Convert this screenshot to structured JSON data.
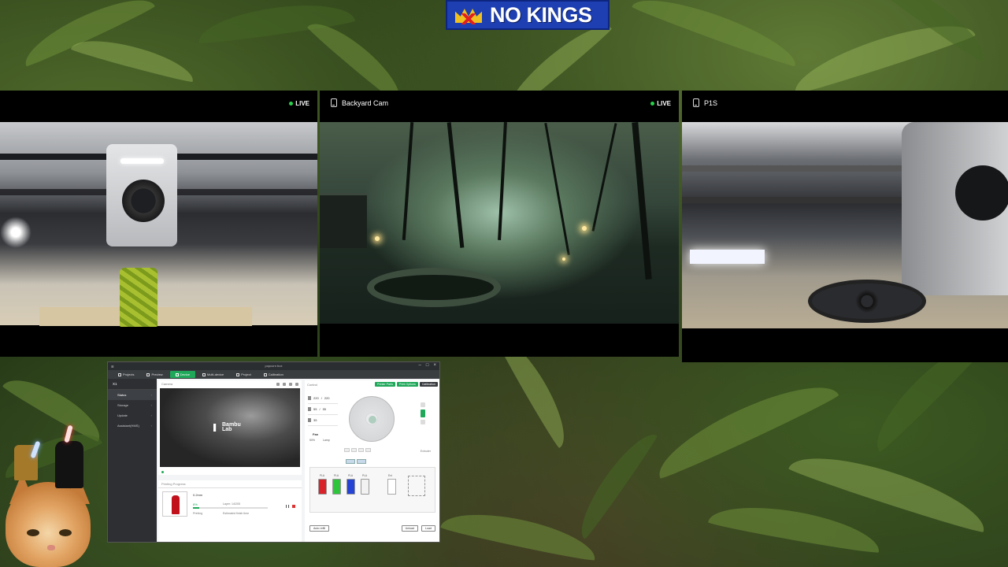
{
  "overlay": {
    "logo_text": "NO KINGS"
  },
  "cameras": [
    {
      "title": "",
      "live_label": "LIVE",
      "live_color": "#29d04a"
    },
    {
      "title": "Backyard Cam",
      "live_label": "LIVE",
      "live_color": "#29d04a"
    },
    {
      "title": "P1S",
      "live_label": ""
    }
  ],
  "bambu_studio": {
    "window_title": "popcorn box",
    "tabs": [
      {
        "label": "Projects",
        "active": false
      },
      {
        "label": "Preview",
        "active": false
      },
      {
        "label": "Device",
        "active": true
      },
      {
        "label": "Multi-device",
        "active": false
      },
      {
        "label": "Project",
        "active": false
      },
      {
        "label": "Calibration",
        "active": false
      }
    ],
    "accent_color": "#1fa85a",
    "sidebar": {
      "printer_name": "X1",
      "items": [
        {
          "label": "Status",
          "active": true
        },
        {
          "label": "Storage",
          "active": false
        },
        {
          "label": "Update",
          "active": false
        },
        {
          "label": "Assistant(HMS)",
          "active": false
        }
      ]
    },
    "camera": {
      "header_label": "Camera",
      "brand_text_1": "Bambu",
      "brand_text_2": "Lab"
    },
    "printing": {
      "header_label": "Printing Progress",
      "file_name": "0.2mm",
      "percent_text": "8%",
      "progress": 0.08,
      "layers_text": "Layer: 14/205",
      "stage_text": "Printing",
      "remaining_text": "Estimated finish time"
    },
    "control": {
      "header_label": "Control",
      "buttons": [
        "Printer Parts",
        "Print Options",
        "Calibration"
      ],
      "temps": [
        {
          "value": "220",
          "target": "220"
        },
        {
          "value": "55",
          "target": "55"
        },
        {
          "value": "35",
          "target": ""
        }
      ],
      "fan_label": "Fan",
      "fan_speed": "50%",
      "lamp_label": "Lamp",
      "extruder_label": "Extruder",
      "ams_spools": [
        {
          "label": "PLA",
          "color": "#d8232a"
        },
        {
          "label": "PLA",
          "color": "#2ec43b"
        },
        {
          "label": "PLA",
          "color": "#2544d6"
        },
        {
          "label": "PLA",
          "color": "#f2f2f2"
        }
      ],
      "ext_spool_label": "Ext",
      "ams_settings_label": "Auto refill",
      "unload_label": "Unload",
      "load_label": "Load"
    }
  }
}
